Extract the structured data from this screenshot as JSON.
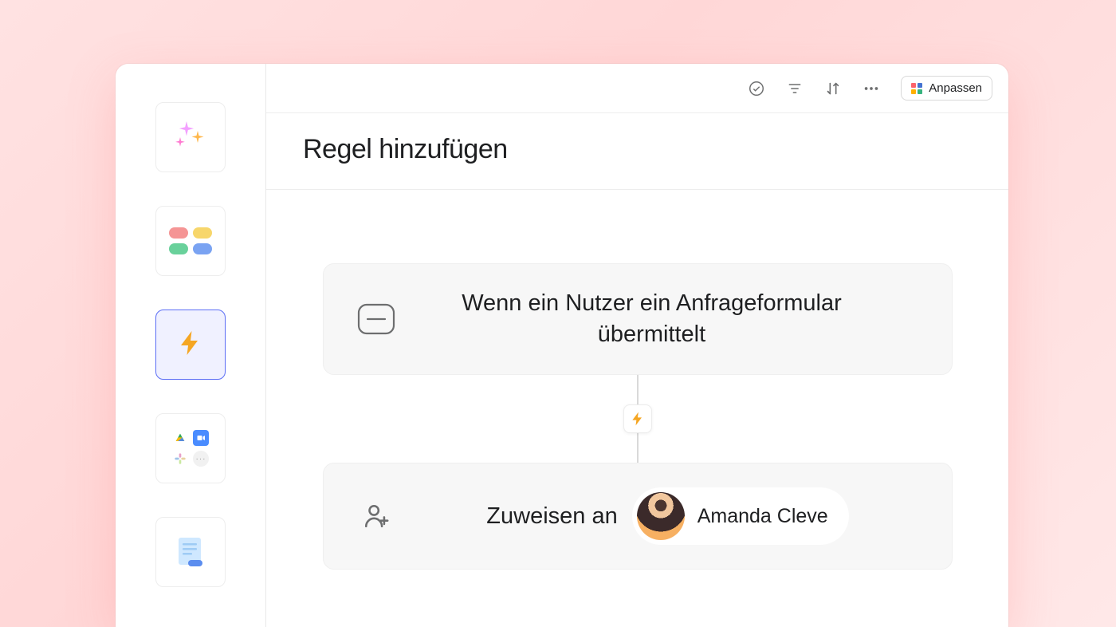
{
  "topbar": {
    "customize_label": "Anpassen"
  },
  "header": {
    "title": "Regel hinzufügen"
  },
  "rule": {
    "trigger_text": "Wenn ein Nutzer ein Anfrageformular übermittelt",
    "action_label": "Zuweisen an",
    "assignee_name": "Amanda Cleve"
  },
  "sidebar": {
    "tiles": [
      {
        "name": "ai-sparkles"
      },
      {
        "name": "fields"
      },
      {
        "name": "rules",
        "active": true
      },
      {
        "name": "integrations"
      },
      {
        "name": "brief"
      }
    ]
  }
}
